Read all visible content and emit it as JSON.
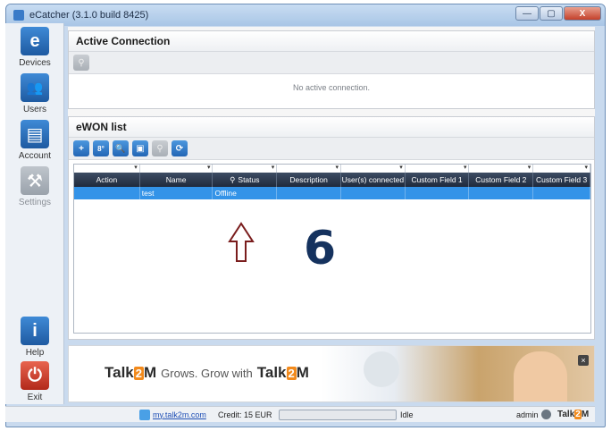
{
  "window": {
    "title": "eCatcher",
    "version": "(3.1.0 build 8425)",
    "controls": {
      "minimize": "—",
      "maximize": "▢",
      "close": "X"
    }
  },
  "sidebar": {
    "items": [
      {
        "label": "Devices",
        "icon": "e",
        "icon_name": "ecatcher-logo-icon"
      },
      {
        "label": "Users",
        "icon": "👥",
        "icon_name": "users-icon"
      },
      {
        "label": "Account",
        "icon": "▤",
        "icon_name": "account-icon"
      },
      {
        "label": "Settings",
        "icon": "⚒",
        "icon_name": "settings-tools-icon"
      },
      {
        "label": "Help",
        "icon": "i",
        "icon_name": "info-icon"
      },
      {
        "label": "Exit",
        "icon": "⏻",
        "icon_name": "power-icon"
      }
    ]
  },
  "active_connection": {
    "title": "Active Connection",
    "empty_message": "No active connection."
  },
  "ewon_list": {
    "title": "eWON list",
    "toolbar": [
      {
        "glyph": "+",
        "icon_name": "add-icon"
      },
      {
        "glyph": "8°",
        "icon_name": "properties-icon"
      },
      {
        "glyph": "🔍",
        "icon_name": "search-icon"
      },
      {
        "glyph": "▣",
        "icon_name": "columns-icon"
      },
      {
        "glyph": "⚲",
        "icon_name": "connect-icon"
      },
      {
        "glyph": "⟳",
        "icon_name": "refresh-icon"
      }
    ],
    "columns": [
      "Action",
      "Name",
      "Status",
      "Description",
      "User(s) connected",
      "Custom Field 1",
      "Custom Field 2",
      "Custom Field 3"
    ],
    "rows": [
      {
        "action": "",
        "name": "test",
        "status": "Offline",
        "description": "",
        "users": "",
        "cf1": "",
        "cf2": "",
        "cf3": ""
      }
    ]
  },
  "annotation": {
    "number": "6"
  },
  "banner": {
    "brand_prefix": "Talk",
    "brand_two": "2",
    "brand_suffix": "M",
    "tagline": "Grows. Grow with",
    "close_glyph": "×"
  },
  "statusbar": {
    "link": "my.talk2m.com",
    "credit": "Credit: 15 EUR",
    "state": "Idle",
    "user": "admin",
    "logo_prefix": "Talk",
    "logo_two": "2",
    "logo_suffix": "M"
  }
}
